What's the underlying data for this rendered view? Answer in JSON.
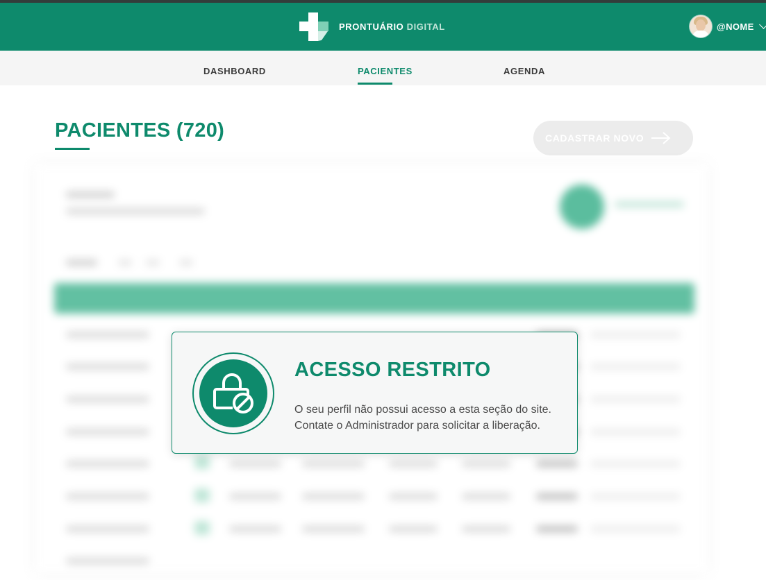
{
  "app": {
    "brand_primary": "PRONTUÁRIO",
    "brand_accent": "DIGITAL",
    "user_name": "@NOME",
    "colors": {
      "primary": "#0e8a6c",
      "nav_bg": "#f5f5f5",
      "accent_light": "#bfe3d7"
    }
  },
  "nav": {
    "items": [
      {
        "label": "DASHBOARD"
      },
      {
        "label": "PACIENTES"
      },
      {
        "label": "AGENDA"
      }
    ],
    "active": "PACIENTES"
  },
  "main": {
    "title": "PACIENTES (720)",
    "new_button_label": "CADASTRAR NOVO"
  },
  "modal": {
    "title": "ACESSO RESTRITO",
    "line1": "O seu perfil não possui acesso a esta seção do site.",
    "line2": "Contate o Administrador para solicitar a liberação.",
    "icon": "lock-blocked-icon"
  }
}
